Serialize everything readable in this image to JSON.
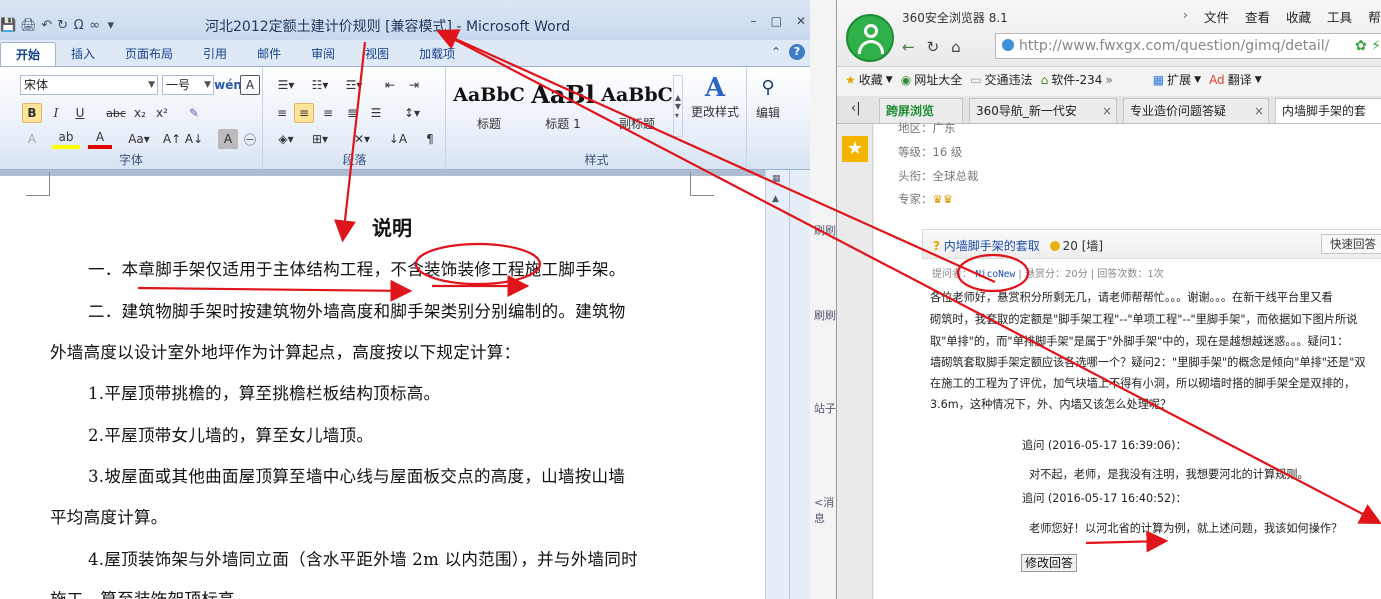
{
  "word": {
    "title": "河北2012定额土建计价规则 [兼容模式] - Microsoft Word",
    "window_controls": [
      "–",
      "□",
      "✕"
    ],
    "tabs": [
      "开始",
      "插入",
      "页面布局",
      "引用",
      "邮件",
      "审阅",
      "视图",
      "加载项"
    ],
    "ribbon": {
      "font_name": "宋体",
      "font_size": "一号",
      "groups": [
        "字体",
        "段落",
        "样式"
      ],
      "styles": [
        {
          "preview": "AaBbC",
          "label": "标题"
        },
        {
          "preview": "AaBl",
          "label": "标题 1"
        },
        {
          "preview": "AaBbC",
          "label": "副标题"
        }
      ],
      "change_styles": "更改样式",
      "edit": "编辑"
    },
    "doc": {
      "heading": "说明",
      "lines": [
        "一．本章脚手架仅适用于主体结构工程，不含装饰装修工程施工脚手架。",
        "二．建筑物脚手架时按建筑物外墙高度和脚手架类别分别编制的。建筑物",
        "外墙高度以设计室外地坪作为计算起点，高度按以下规定计算：",
        "1.平屋顶带挑檐的，算至挑檐栏板结构顶标高。",
        "2.平屋顶带女儿墙的，算至女儿墙顶。",
        "3.坡屋面或其他曲面屋顶算至墙中心线与屋面板交点的高度，山墙按山墙",
        "平均高度计算。",
        "4.屋顶装饰架与外墙同立面（含水平距外墙 2m 以内范围），并与外墙同时",
        "施工，算至装饰架顶标高。"
      ]
    }
  },
  "browser": {
    "name": "360安全浏览器 8.1",
    "menu": [
      "文件",
      "查看",
      "收藏",
      "工具",
      "帮助"
    ],
    "url": "http://www.fwxgx.com/question/gimq/detail/",
    "favorites": [
      "收藏",
      "网址大全",
      "交通违法",
      "软件-234",
      "扩展",
      "翻译"
    ],
    "tabs": [
      {
        "label": "跨屏浏览"
      },
      {
        "label": "360导航_新一代安"
      },
      {
        "label": "专业造价问题答疑"
      },
      {
        "label": "内墙脚手架的套"
      }
    ],
    "profile": {
      "region": "地区：广东",
      "level": "等级：16 级",
      "rank": "头衔：全球总裁",
      "expert": "专家："
    },
    "question": {
      "title": "内墙脚手架的套取",
      "reward": "20",
      "tag": "[墙]",
      "quick_answer": "快速回答",
      "asker_label": "提问者：",
      "asker": "NicoNew",
      "meta": "| 悬赏分：20分 | 回答次数：1次",
      "body": [
        "各位老师好，悬赏积分所剩无几，请老师帮帮忙。。。谢谢。。。在新干线平台里又看",
        "砌筑时，我套取的定额是\"脚手架工程\"--\"单项工程\"--\"里脚手架\"，而依据如下图片所说",
        "取\"单排\"的，而\"单排脚手架\"是属于\"外脚手架\"中的，现在是越想越迷惑。。。疑问1：",
        "墙砌筑套取脚手架定额应该各选哪一个？疑问2：\"里脚手架\"的概念是倾向\"单排\"还是\"双",
        "在施工的工程为了评优，加气块墙上不得有小洞，所以砌墙时搭的脚手架全是双排的，",
        "3.6m，这种情况下，外、内墙又该怎么处理呢？"
      ]
    },
    "followups": [
      {
        "time": "追问 (2016-05-17 16:39:06)：",
        "text": "对不起，老师，是我没有注明，我想要河北的计算规则。"
      },
      {
        "time": "追问 (2016-05-17 16:40:52)：",
        "text": "老师您好！以河北省的计算为例，就上述问题，我该如何操作？"
      }
    ],
    "edit_answer": "修改回答"
  },
  "background_strip": [
    "刷刷",
    "刷刷",
    "站子",
    "<消息"
  ],
  "colors": {
    "annotation_red": "#e0141b",
    "word_blue": "#15428b",
    "link_blue": "#1a4da8"
  }
}
